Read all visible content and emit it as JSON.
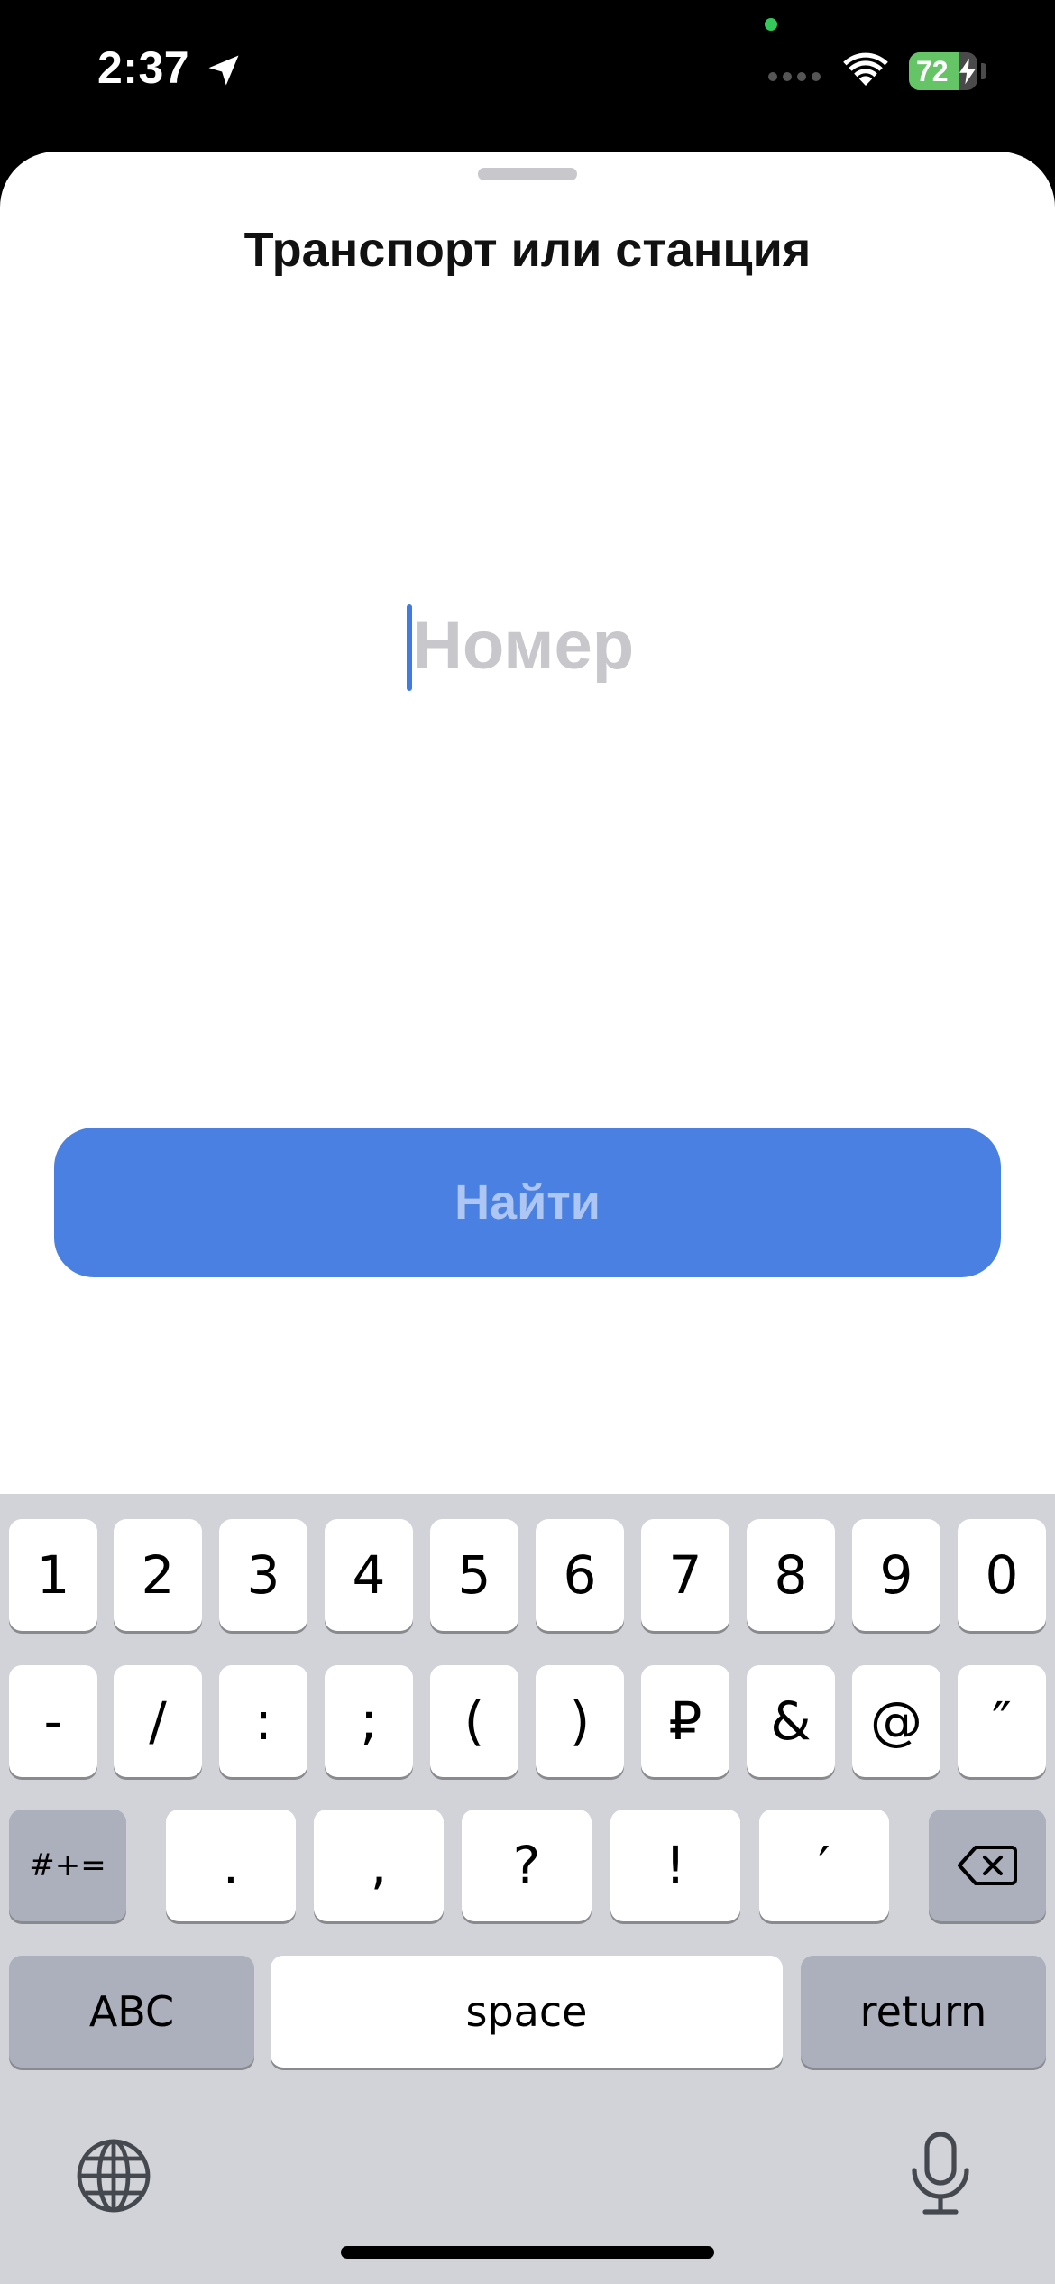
{
  "status_bar": {
    "time": "2:37",
    "battery_level": "72",
    "battery_fraction": 0.72,
    "icons": [
      "location-arrow-icon",
      "cellular-dots-icon",
      "wifi-icon",
      "battery-icon",
      "charging-bolt-icon"
    ]
  },
  "sheet": {
    "title": "Транспорт или станция",
    "input": {
      "placeholder": "Номер",
      "value": ""
    },
    "find_button_label": "Найти"
  },
  "keyboard": {
    "row1": [
      "1",
      "2",
      "3",
      "4",
      "5",
      "6",
      "7",
      "8",
      "9",
      "0"
    ],
    "row2": [
      "-",
      "/",
      ":",
      ";",
      "(",
      ")",
      "₽",
      "&",
      "@",
      "″"
    ],
    "row3": {
      "toggle_label": "#+=",
      "keys": [
        ".",
        ",",
        "?",
        "!",
        "′"
      ]
    },
    "row4": {
      "abc_label": "ABC",
      "space_label": "space",
      "return_label": "return"
    },
    "icons": [
      "delete-icon",
      "globe-icon",
      "microphone-icon"
    ]
  },
  "colors": {
    "accent": "#4a80e1",
    "battery_green": "#65c466",
    "keyboard_bg": "#d1d3d9"
  }
}
